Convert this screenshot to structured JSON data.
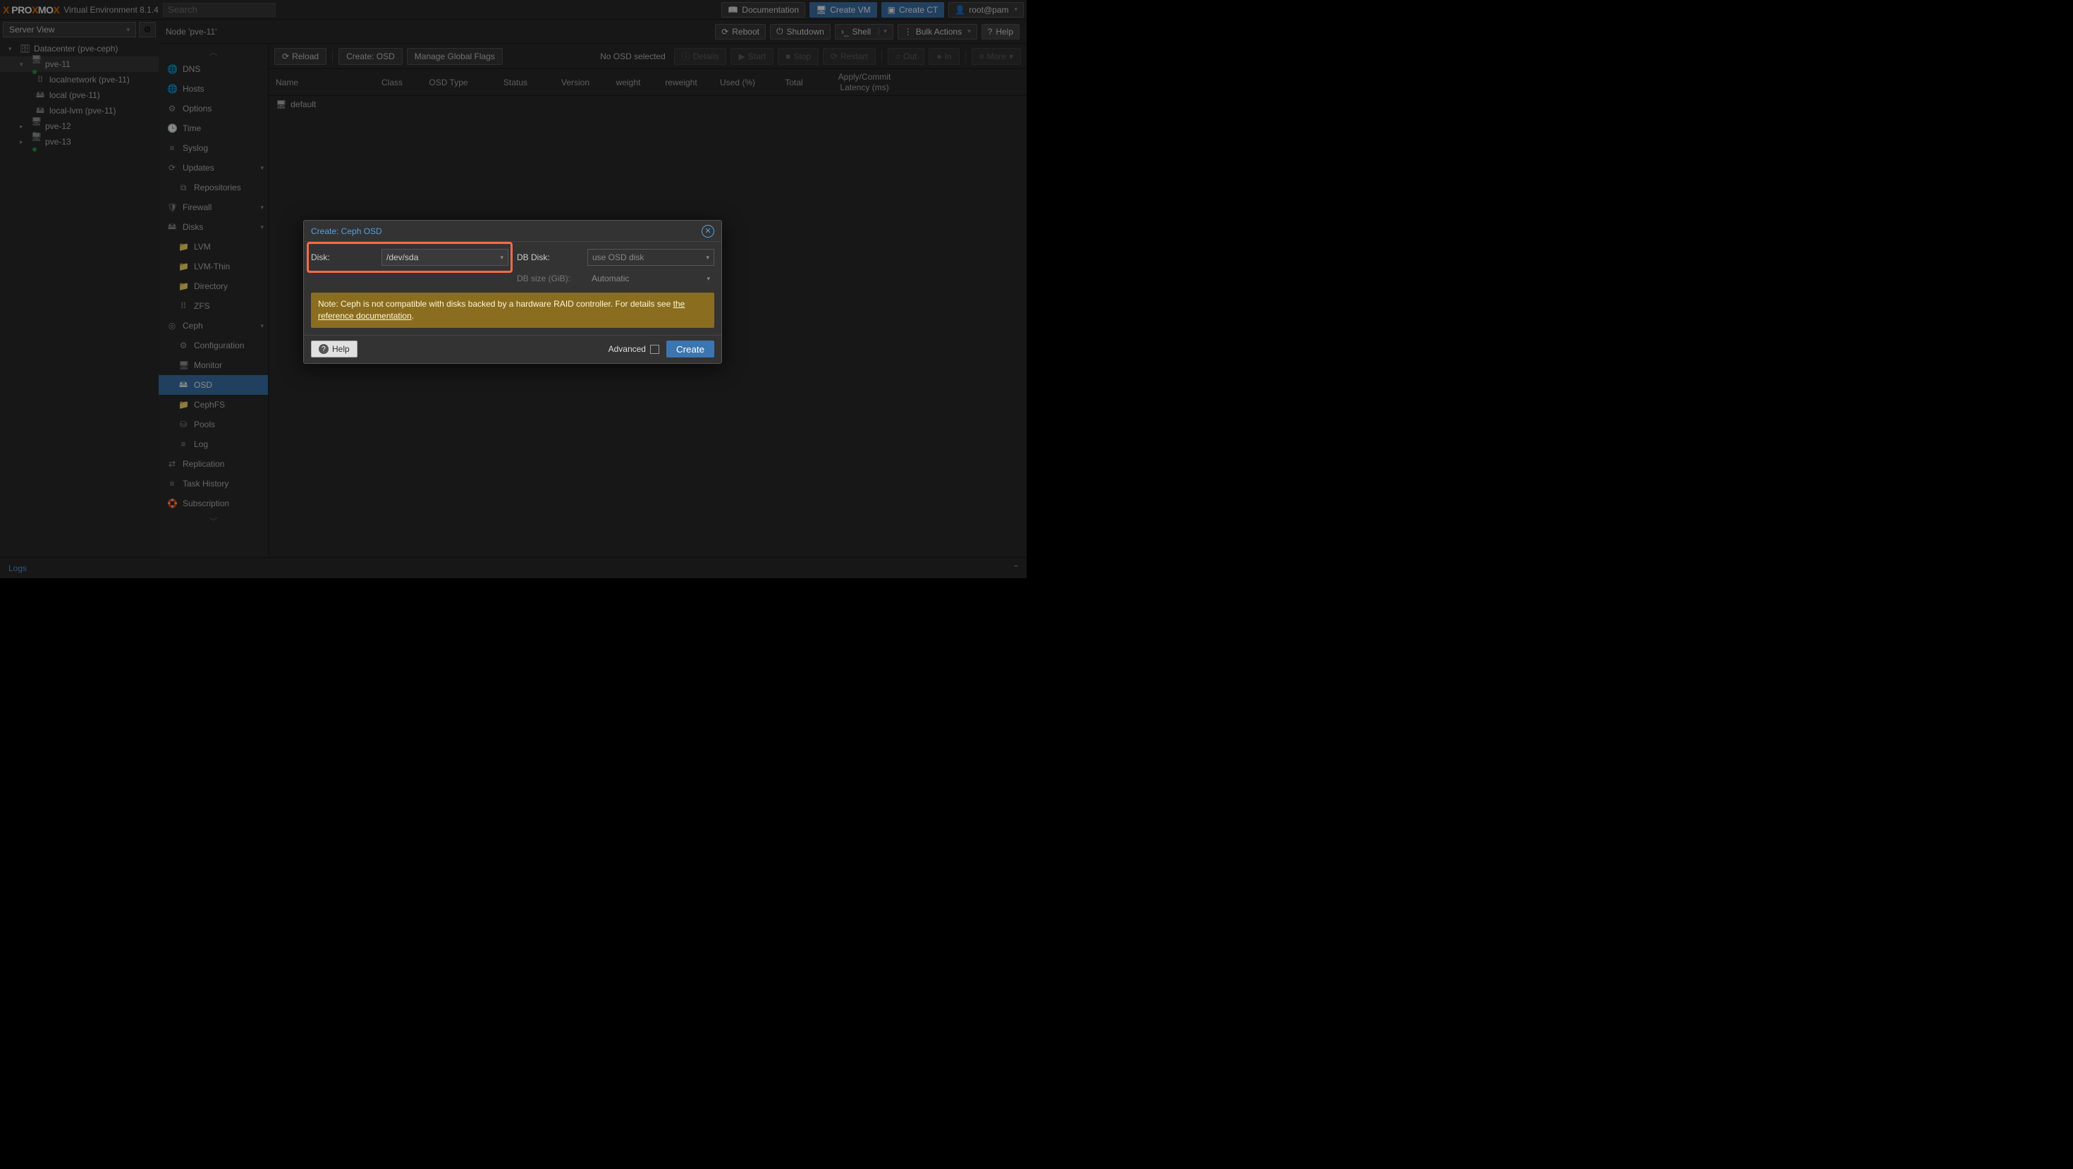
{
  "header": {
    "product": "PROXMOX",
    "subtitle": "Virtual Environment 8.1.4",
    "search_placeholder": "Search",
    "doc": "Documentation",
    "create_vm": "Create VM",
    "create_ct": "Create CT",
    "user": "root@pam"
  },
  "left": {
    "view_label": "Server View",
    "tree": {
      "datacenter": "Datacenter (pve-ceph)",
      "nodes": [
        {
          "name": "pve-11",
          "selected": true,
          "children": [
            "localnetwork (pve-11)",
            "local (pve-11)",
            "local-lvm (pve-11)"
          ]
        },
        {
          "name": "pve-12"
        },
        {
          "name": "pve-13"
        }
      ]
    }
  },
  "node_header": {
    "title": "Node 'pve-11'",
    "reboot": "Reboot",
    "shutdown": "Shutdown",
    "shell": "Shell",
    "bulk": "Bulk Actions",
    "help": "Help"
  },
  "sidenav": [
    {
      "icon": "globe",
      "label": "DNS"
    },
    {
      "icon": "globe",
      "label": "Hosts"
    },
    {
      "icon": "cog",
      "label": "Options"
    },
    {
      "icon": "clock",
      "label": "Time"
    },
    {
      "icon": "list",
      "label": "Syslog"
    },
    {
      "icon": "refresh",
      "label": "Updates",
      "expand": true
    },
    {
      "icon": "repo",
      "label": "Repositories",
      "sub": true
    },
    {
      "icon": "shield",
      "label": "Firewall",
      "expand": true
    },
    {
      "icon": "disk",
      "label": "Disks",
      "expand": true
    },
    {
      "icon": "folder",
      "label": "LVM",
      "sub": true
    },
    {
      "icon": "folder",
      "label": "LVM-Thin",
      "sub": true
    },
    {
      "icon": "folder",
      "label": "Directory",
      "sub": true
    },
    {
      "icon": "grid",
      "label": "ZFS",
      "sub": true
    },
    {
      "icon": "ceph",
      "label": "Ceph",
      "expand": true
    },
    {
      "icon": "cog",
      "label": "Configuration",
      "sub": true
    },
    {
      "icon": "monitor",
      "label": "Monitor",
      "sub": true
    },
    {
      "icon": "disk",
      "label": "OSD",
      "sub": true,
      "selected": true
    },
    {
      "icon": "folder",
      "label": "CephFS",
      "sub": true
    },
    {
      "icon": "pools",
      "label": "Pools",
      "sub": true
    },
    {
      "icon": "list",
      "label": "Log",
      "sub": true
    },
    {
      "icon": "repl",
      "label": "Replication"
    },
    {
      "icon": "list",
      "label": "Task History"
    },
    {
      "icon": "support",
      "label": "Subscription"
    }
  ],
  "toolbar": {
    "reload": "Reload",
    "create_osd": "Create: OSD",
    "manage_flags": "Manage Global Flags",
    "no_osd": "No OSD selected",
    "details": "Details",
    "start": "Start",
    "stop": "Stop",
    "restart": "Restart",
    "out": "Out",
    "in": "In",
    "more": "More"
  },
  "columns": {
    "name": "Name",
    "class": "Class",
    "type": "OSD Type",
    "status": "Status",
    "version": "Version",
    "weight": "weight",
    "reweight": "reweight",
    "used": "Used (%)",
    "total": "Total",
    "latency": "Apply/Commit Latency (ms)"
  },
  "rows": [
    {
      "name": "default"
    }
  ],
  "bottom": {
    "logs": "Logs"
  },
  "modal": {
    "title": "Create: Ceph OSD",
    "disk_label": "Disk:",
    "disk_value": "/dev/sda",
    "dbdisk_label": "DB Disk:",
    "dbdisk_value": "use OSD disk",
    "dbsize_label": "DB size (GiB):",
    "dbsize_value": "Automatic",
    "note_prefix": "Note: Ceph is not compatible with disks backed by a hardware RAID controller. For details see ",
    "note_link": "the reference documentation",
    "note_suffix": ".",
    "help": "Help",
    "advanced": "Advanced",
    "create": "Create"
  }
}
